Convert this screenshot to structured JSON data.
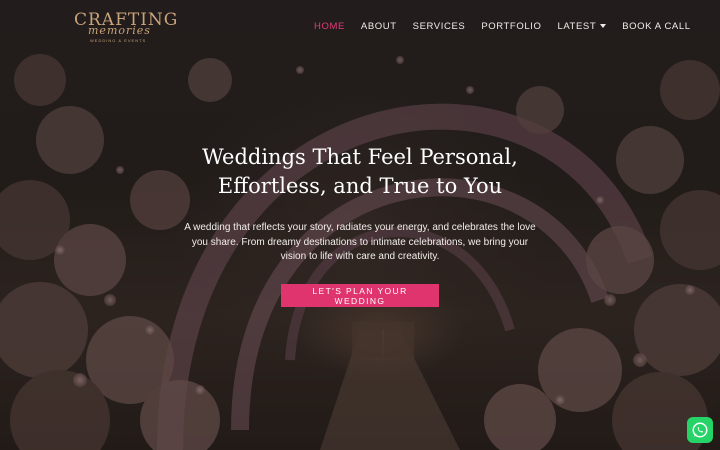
{
  "brand": {
    "name": "CRAFTING",
    "script": "memories",
    "tagline": "WEDDING & EVENTS"
  },
  "nav": {
    "items": [
      {
        "label": "HOME",
        "active": true
      },
      {
        "label": "ABOUT",
        "active": false
      },
      {
        "label": "SERVICES",
        "active": false
      },
      {
        "label": "PORTFOLIO",
        "active": false
      },
      {
        "label": "LATEST",
        "active": false,
        "has_dropdown": true
      },
      {
        "label": "BOOK A CALL",
        "active": false
      }
    ]
  },
  "hero": {
    "headline_line1": "Weddings That Feel Personal,",
    "headline_line2": "Effortless, and True to You",
    "subtext": "A wedding that reflects your story, radiates your energy, and celebrates the love you share. From dreamy destinations to intimate celebrations, we bring your vision to life with care and creativity.",
    "cta_label": "LET'S PLAN YOUR WEDDING"
  },
  "colors": {
    "accent": "#e0346f",
    "active_nav": "#e23b7a",
    "logo_gold": "#c9a37a",
    "whatsapp": "#25d366"
  },
  "floating": {
    "whatsapp_icon": "whatsapp-icon"
  }
}
